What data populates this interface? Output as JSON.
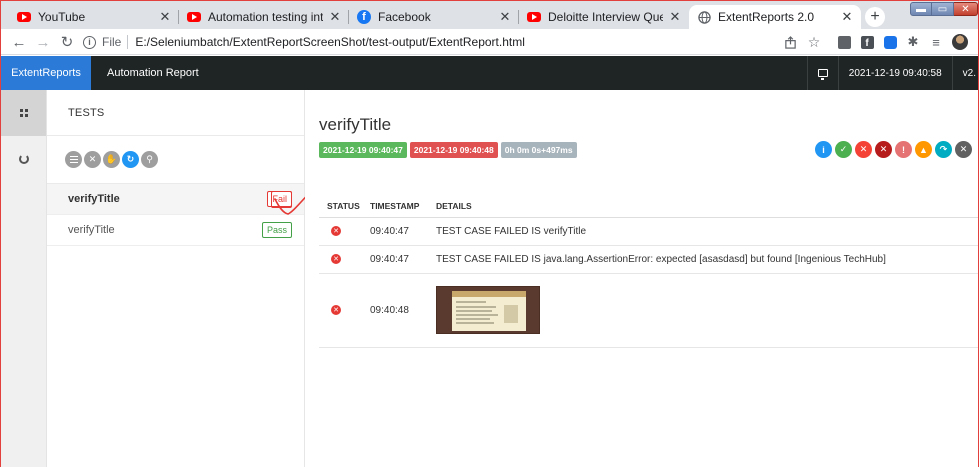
{
  "browser": {
    "tabs": [
      {
        "title": "YouTube",
        "icon": "youtube-icon"
      },
      {
        "title": "Automation testing interview qu",
        "icon": "youtube-icon"
      },
      {
        "title": "Facebook",
        "icon": "facebook-icon"
      },
      {
        "title": "Deloitte Interview Question for",
        "icon": "youtube-icon"
      },
      {
        "title": "ExtentReports 2.0",
        "icon": "globe-icon",
        "active": true
      }
    ],
    "new_tab": "+",
    "address": {
      "scheme_label": "File",
      "url": "E:/Seleniumbatch/ExtentReportScreenShot/test-output/ExtentReport.html"
    }
  },
  "app": {
    "brand": "ExtentReports",
    "title": "Automation Report",
    "timestamp": "2021-12-19 09:40:58",
    "version": "v2."
  },
  "tests_pane": {
    "heading": "TESTS",
    "items": [
      {
        "name": "verifyTitle",
        "status": "Fail"
      },
      {
        "name": "verifyTitle",
        "status": "Pass"
      }
    ]
  },
  "detail": {
    "title": "verifyTitle",
    "badges": {
      "start": "2021-12-19 09:40:47",
      "end": "2021-12-19 09:40:48",
      "duration": "0h 0m 0s+497ms"
    },
    "columns": {
      "status": "STATUS",
      "timestamp": "TIMESTAMP",
      "details": "DETAILS"
    },
    "steps": [
      {
        "status": "fail",
        "timestamp": "09:40:47",
        "details": "TEST CASE FAILED IS verifyTitle"
      },
      {
        "status": "fail",
        "timestamp": "09:40:47",
        "details": "TEST CASE FAILED IS java.lang.AssertionError: expected [asasdasd] but found [Ingenious TechHub]"
      },
      {
        "status": "fail",
        "timestamp": "09:40:48",
        "details": ""
      }
    ]
  },
  "colors": {
    "brand": "#2b7ad7",
    "navbar": "#1f2424",
    "fail": "#e53935",
    "pass": "#43a047",
    "badge_start": "#5cb85c",
    "badge_end": "#e05252",
    "badge_duration": "#a8b4bc"
  }
}
